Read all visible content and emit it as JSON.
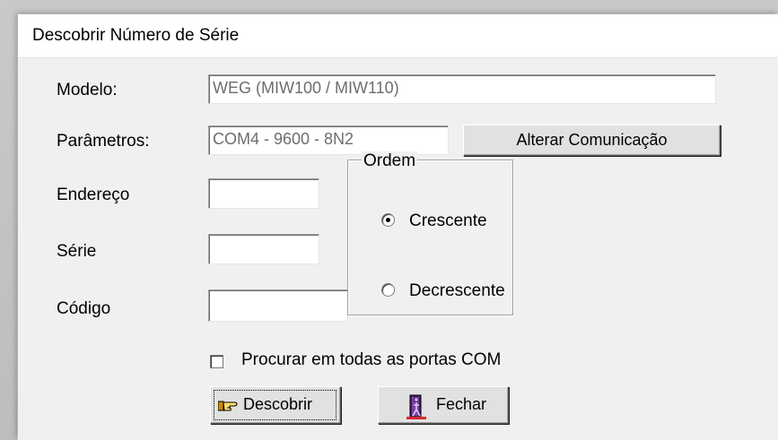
{
  "window": {
    "title": "Descobrir Número de Série"
  },
  "labels": {
    "modelo": "Modelo:",
    "parametros": "Parâmetros:",
    "endereco": "Endereço",
    "serie": "Série",
    "codigo": "Código"
  },
  "fields": {
    "modelo": {
      "value": "WEG (MIW100 / MIW110)"
    },
    "parametros": {
      "value": "COM4 - 9600 - 8N2"
    },
    "endereco": {
      "value": ""
    },
    "serie": {
      "value": ""
    },
    "codigo": {
      "value": ""
    }
  },
  "buttons": {
    "alterar_comunicacao": "Alterar Comunicação",
    "descobrir": "Descobrir",
    "fechar": "Fechar"
  },
  "ordem": {
    "legend": "Ordem",
    "options": [
      {
        "label": "Crescente",
        "selected": true
      },
      {
        "label": "Decrescente",
        "selected": false
      }
    ]
  },
  "checkbox_all_ports": {
    "label": "Procurar em todas as portas COM",
    "checked": false
  },
  "icons": {
    "descobrir": "pointing-hand-icon",
    "fechar": "door-exit-icon"
  },
  "colors": {
    "dialog_bg": "#f0f0f0",
    "disabled_text": "#6d6d6d"
  }
}
